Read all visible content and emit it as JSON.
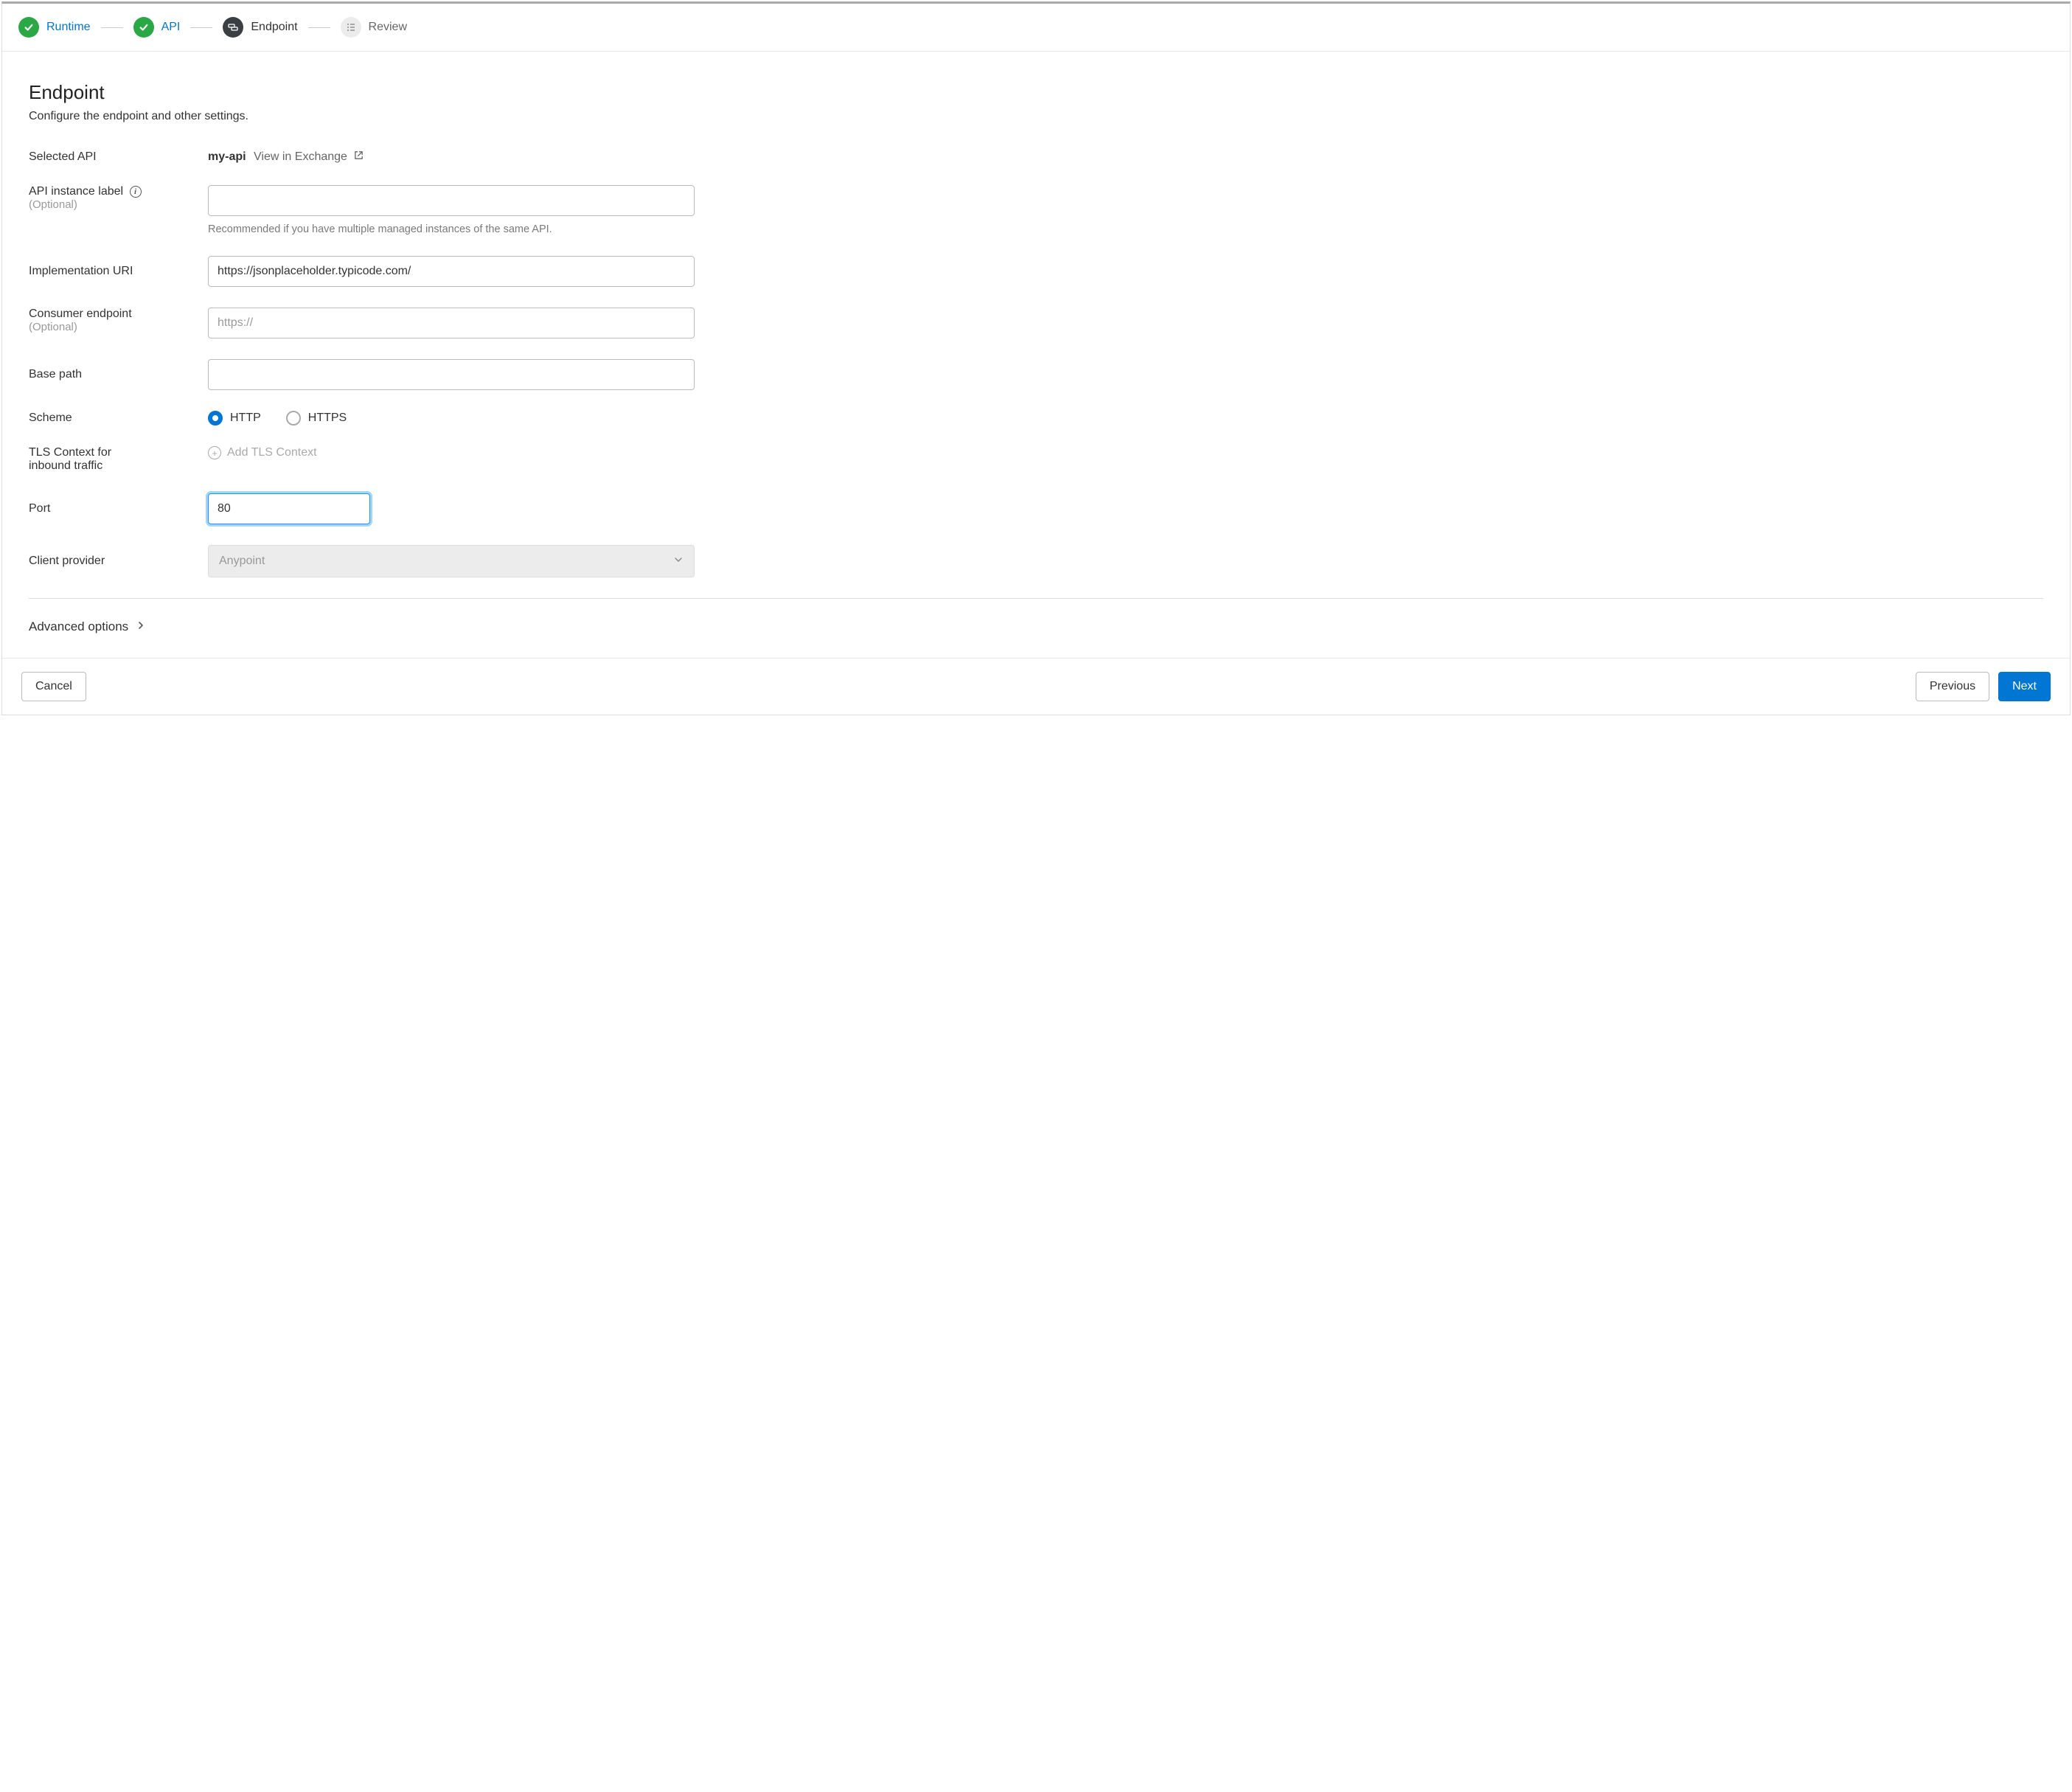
{
  "stepper": {
    "steps": [
      {
        "label": "Runtime",
        "state": "done"
      },
      {
        "label": "API",
        "state": "done"
      },
      {
        "label": "Endpoint",
        "state": "current"
      },
      {
        "label": "Review",
        "state": "pending"
      }
    ]
  },
  "header": {
    "title": "Endpoint",
    "subtitle": "Configure the endpoint and other settings."
  },
  "selectedApi": {
    "label": "Selected API",
    "name": "my-api",
    "viewLink": "View in Exchange"
  },
  "apiInstanceLabel": {
    "label": "API instance label",
    "optional": "(Optional)",
    "value": "",
    "help": "Recommended if you have multiple managed instances of the same API."
  },
  "implementationUri": {
    "label": "Implementation URI",
    "value": "https://jsonplaceholder.typicode.com/"
  },
  "consumerEndpoint": {
    "label": "Consumer endpoint",
    "optional": "(Optional)",
    "placeholder": "https://",
    "value": ""
  },
  "basePath": {
    "label": "Base path",
    "value": ""
  },
  "scheme": {
    "label": "Scheme",
    "options": [
      "HTTP",
      "HTTPS"
    ],
    "selected": "HTTP"
  },
  "tlsContext": {
    "label": "TLS Context for inbound traffic",
    "addLabel": "Add TLS Context"
  },
  "port": {
    "label": "Port",
    "value": "80"
  },
  "clientProvider": {
    "label": "Client provider",
    "value": "Anypoint"
  },
  "advanced": {
    "label": "Advanced options"
  },
  "footer": {
    "cancel": "Cancel",
    "previous": "Previous",
    "next": "Next"
  }
}
